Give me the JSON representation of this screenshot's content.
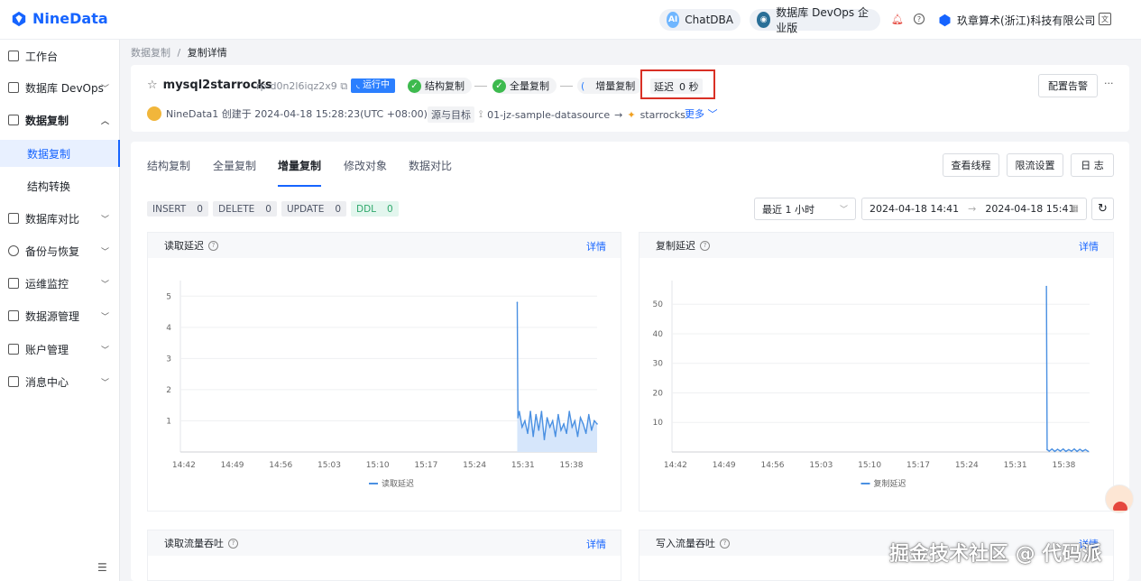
{
  "header": {
    "brand": "NineData",
    "chatdba": "ChatDBA",
    "edition": "数据库 DevOps 企业版",
    "org": "玖章算术(浙江)科技有限公司"
  },
  "sidebar": {
    "items": [
      {
        "label": "工作台"
      },
      {
        "label": "数据库 DevOps"
      },
      {
        "label": "数据复制"
      },
      {
        "label": "数据库对比"
      },
      {
        "label": "备份与恢复"
      },
      {
        "label": "运维监控"
      },
      {
        "label": "数据源管理"
      },
      {
        "label": "账户管理"
      },
      {
        "label": "消息中心"
      }
    ],
    "sub_items": [
      {
        "label": "数据复制"
      },
      {
        "label": "结构转换"
      }
    ]
  },
  "breadcrumb": {
    "parent": "数据复制",
    "sep": "/",
    "current": "复制详情"
  },
  "task": {
    "name": "mysql2starrocks",
    "id": "rp-d0n2l6iqz2x9",
    "status": "运行中",
    "steps": [
      "结构复制",
      "全量复制",
      "增量复制"
    ],
    "delay_label": "延迟",
    "delay_value": "0 秒",
    "alert_button": "配置告警",
    "more_icon": "···",
    "creator_line": "NineData1 创建于 2024-04-18 15:28:23(UTC +08:00)",
    "source_target_label": "源与目标",
    "source": "01-jz-sample-datasource",
    "target": "starrocks",
    "more_link": "更多"
  },
  "tabs": [
    "结构复制",
    "全量复制",
    "增量复制",
    "修改对象",
    "数据对比"
  ],
  "actions": {
    "threads": "查看线程",
    "throttle": "限流设置",
    "log": "日 志"
  },
  "stats": [
    {
      "label": "INSERT",
      "value": "0"
    },
    {
      "label": "DELETE",
      "value": "0"
    },
    {
      "label": "UPDATE",
      "value": "0"
    },
    {
      "label": "DDL",
      "value": "0"
    }
  ],
  "time_filter": {
    "preset": "最近 1 小时",
    "start": "2024-04-18 14:41",
    "end": "2024-04-18 15:41"
  },
  "panels": {
    "read_delay": {
      "title": "读取延迟",
      "detail": "详情",
      "legend": "读取延迟"
    },
    "repl_delay": {
      "title": "复制延迟",
      "detail": "详情",
      "legend": "复制延迟"
    },
    "read_throughput": {
      "title": "读取流量吞吐",
      "detail": "详情"
    },
    "write_throughput": {
      "title": "写入流量吞吐",
      "detail": "详情"
    }
  },
  "watermark": "掘金技术社区 @ 代码派",
  "colors": {
    "accent": "#1664ff",
    "line": "#4a90e2",
    "area": "#d6e6fb",
    "ok": "#3dba4e",
    "highlight": "#d93025"
  },
  "chart_data": [
    {
      "type": "area",
      "title": "读取延迟",
      "categories": [
        "14:42",
        "14:49",
        "14:56",
        "15:03",
        "15:10",
        "15:17",
        "15:24",
        "15:31",
        "15:38"
      ],
      "yticks": [
        1,
        2,
        3,
        4,
        5
      ],
      "ylim": [
        0,
        5.5
      ],
      "xlim": [
        0,
        60
      ],
      "series": [
        {
          "name": "读取延迟",
          "x": [
            48.5,
            48.6,
            48.8,
            49.2,
            49.6,
            50.0,
            50.4,
            50.8,
            51.2,
            51.6,
            52.0,
            52.4,
            52.8,
            53.2,
            53.6,
            54.0,
            54.4,
            54.8,
            55.2,
            55.6,
            56.0,
            56.4,
            56.8,
            57.2,
            57.6,
            58.0,
            58.4,
            58.8,
            59.2,
            59.6,
            60.0
          ],
          "values": [
            4.8,
            1.1,
            1.3,
            0.8,
            1.0,
            0.6,
            1.3,
            0.5,
            1.2,
            0.7,
            1.3,
            0.4,
            1.1,
            0.8,
            1.0,
            0.5,
            1.2,
            0.7,
            0.9,
            0.6,
            1.3,
            0.8,
            1.0,
            0.5,
            1.1,
            0.9,
            0.6,
            1.2,
            0.7,
            1.0,
            0.9
          ]
        }
      ]
    },
    {
      "type": "line",
      "title": "复制延迟",
      "categories": [
        "14:42",
        "14:49",
        "14:56",
        "15:03",
        "15:10",
        "15:17",
        "15:24",
        "15:31",
        "15:38"
      ],
      "yticks": [
        10,
        20,
        30,
        40,
        50
      ],
      "ylim": [
        0,
        58
      ],
      "xlim": [
        0,
        60
      ],
      "series": [
        {
          "name": "复制延迟",
          "x": [
            53.8,
            53.9,
            54.2,
            54.6,
            55.0,
            55.4,
            55.8,
            56.2,
            56.6,
            57.0,
            57.4,
            57.8,
            58.2,
            58.6,
            59.0,
            59.4,
            59.8
          ],
          "values": [
            56,
            0.8,
            0.3,
            1.0,
            0.2,
            0.9,
            0.3,
            1.0,
            0.2,
            0.8,
            0.3,
            1.0,
            0.2,
            0.9,
            0.3,
            0.8,
            0.2
          ]
        }
      ]
    }
  ]
}
